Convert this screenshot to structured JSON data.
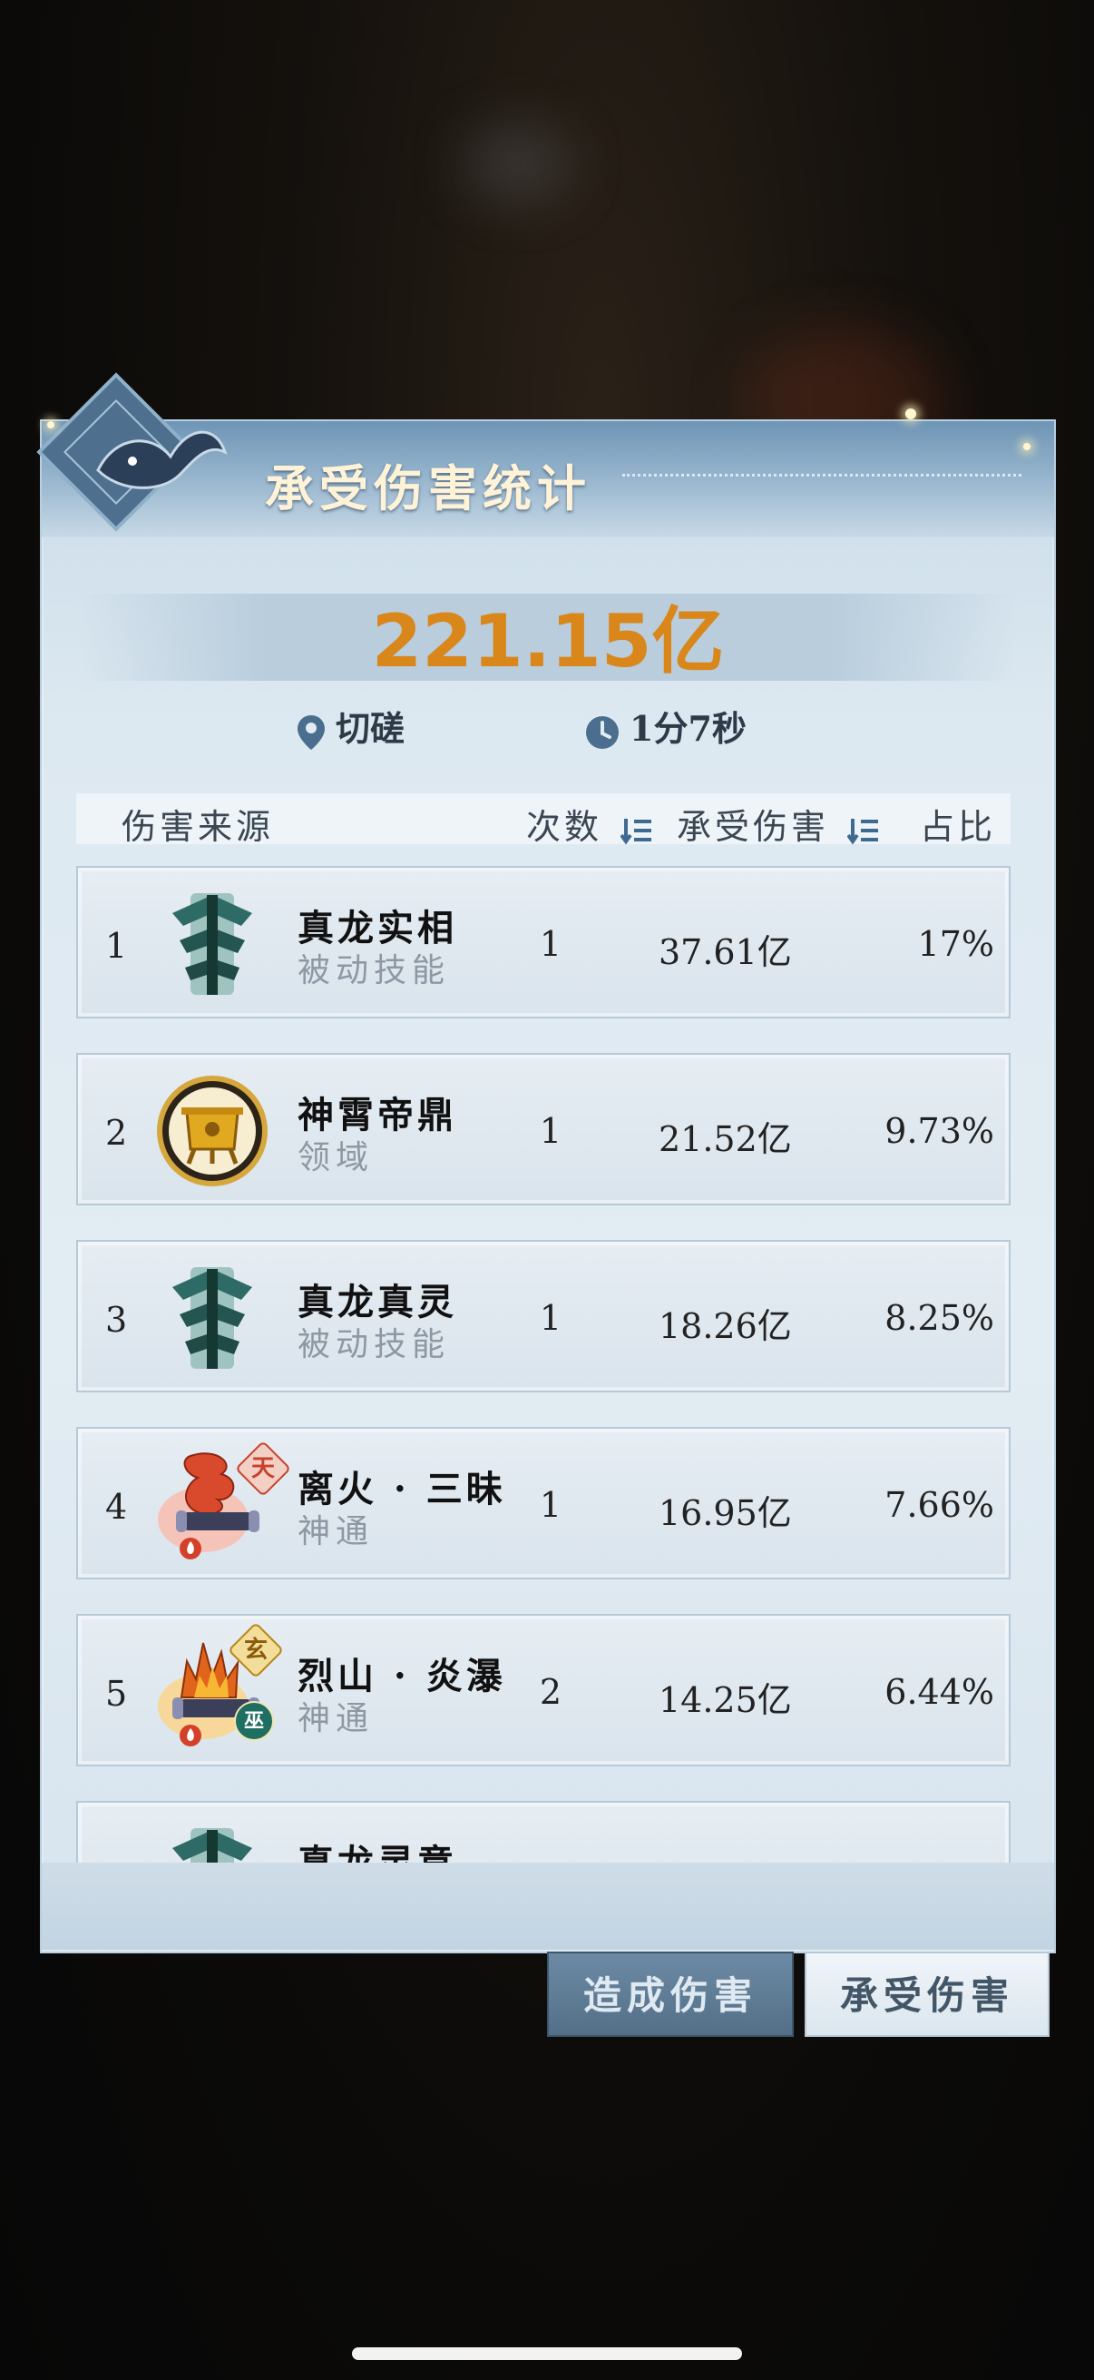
{
  "panel": {
    "title": "承受伤害统计",
    "total": "221.15亿",
    "location": "切磋",
    "duration": "1分7秒"
  },
  "table": {
    "headers": {
      "source": "伤害来源",
      "count": "次数",
      "damage": "承受伤害",
      "ratio": "占比"
    },
    "rows": [
      {
        "index": "1",
        "name": "真龙实相",
        "type": "被动技能",
        "count": "1",
        "damage": "37.61亿",
        "ratio": "17%",
        "icon": "dragon-totem-icon"
      },
      {
        "index": "2",
        "name": "神霄帝鼎",
        "type": "领域",
        "count": "1",
        "damage": "21.52亿",
        "ratio": "9.73%",
        "icon": "golden-cauldron-icon"
      },
      {
        "index": "3",
        "name": "真龙真灵",
        "type": "被动技能",
        "count": "1",
        "damage": "18.26亿",
        "ratio": "8.25%",
        "icon": "dragon-totem-icon"
      },
      {
        "index": "4",
        "name": "离火 · 三昧",
        "type": "神通",
        "count": "1",
        "damage": "16.95亿",
        "ratio": "7.66%",
        "icon": "fire-scroll-icon",
        "badge": "天"
      },
      {
        "index": "5",
        "name": "烈山 · 炎瀑",
        "type": "神通",
        "count": "2",
        "damage": "14.25亿",
        "ratio": "6.44%",
        "icon": "flame-scroll-icon",
        "badge": "玄",
        "badge2": "巫"
      },
      {
        "index": "",
        "name": "真龙灵意",
        "type": "",
        "count": "",
        "damage": "",
        "ratio": "",
        "icon": "dragon-totem-icon"
      }
    ]
  },
  "tabs": {
    "deal": "造成伤害",
    "take": "承受伤害"
  },
  "colors": {
    "total": "#d9861a",
    "accent": "#536f88"
  }
}
